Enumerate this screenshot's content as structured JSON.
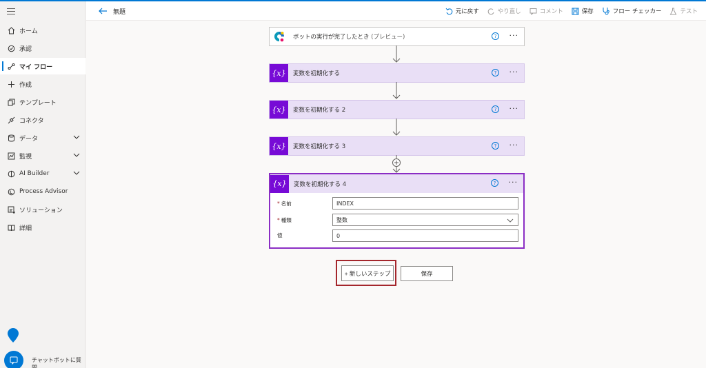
{
  "header": {
    "flow_title": "無題",
    "toolbar": {
      "undo": "元に戻す",
      "redo": "やり直し",
      "comment": "コメント",
      "save": "保存",
      "checker": "フロー チェッカー",
      "test": "テスト"
    }
  },
  "sidebar": {
    "items": [
      {
        "label": "ホーム",
        "icon": "home-icon"
      },
      {
        "label": "承認",
        "icon": "approvals-icon"
      },
      {
        "label": "マイ フロー",
        "icon": "flow-icon"
      },
      {
        "label": "作成",
        "icon": "plus-icon"
      },
      {
        "label": "テンプレート",
        "icon": "template-icon"
      },
      {
        "label": "コネクタ",
        "icon": "connector-icon"
      },
      {
        "label": "データ",
        "icon": "database-icon"
      },
      {
        "label": "監視",
        "icon": "monitor-icon"
      },
      {
        "label": "AI Builder",
        "icon": "ai-builder-icon"
      },
      {
        "label": "Process Advisor",
        "icon": "process-advisor-icon"
      },
      {
        "label": "ソリューション",
        "icon": "solution-icon"
      },
      {
        "label": "詳細",
        "icon": "book-icon"
      }
    ],
    "chatbot_label": "チャットボットに質問"
  },
  "flow": {
    "trigger": {
      "title": "ボットの実行が完了したとき",
      "suffix": "(プレビュー)"
    },
    "steps": [
      {
        "title": "変数を初期化する"
      },
      {
        "title": "変数を初期化する 2"
      },
      {
        "title": "変数を初期化する 3"
      }
    ],
    "open_step": {
      "title": "変数を初期化する 4",
      "fields": {
        "name_label": "名前",
        "name_value": "INDEX",
        "type_label": "種類",
        "type_value": "整数",
        "value_label": "値",
        "value_value": "0"
      }
    },
    "new_step_label": "+ 新しいステップ",
    "save_label": "保存"
  },
  "colors": {
    "accent": "#0078d4",
    "variable_purple": "#770bd6",
    "highlight_red": "#a4262c"
  }
}
